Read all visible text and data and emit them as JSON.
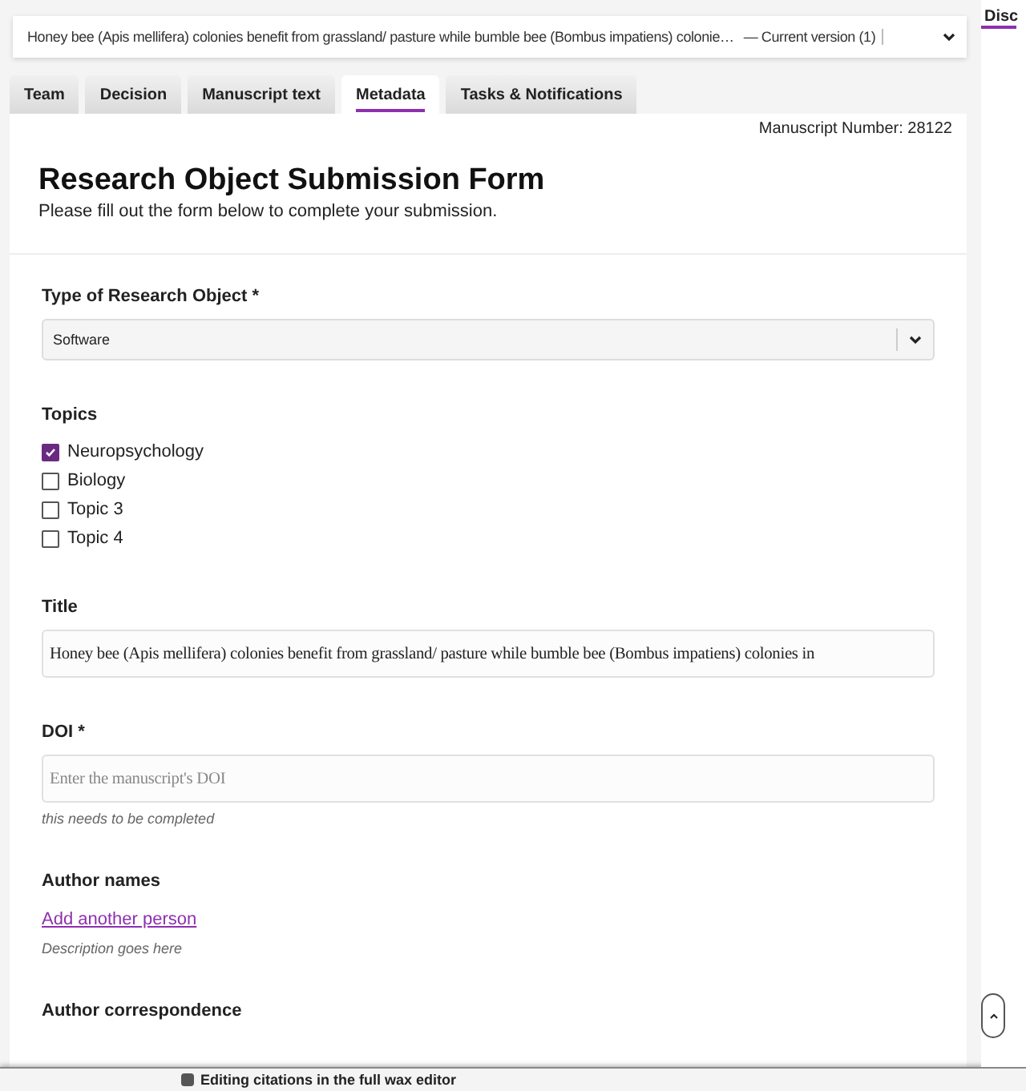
{
  "version_bar": {
    "title": "Honey bee (Apis mellifera) colonies benefit from grassland/ pasture while bumble bee (Bombus impatiens) colonie…",
    "version": "— Current version (1)"
  },
  "tabs": [
    {
      "label": "Team",
      "selected": false
    },
    {
      "label": "Decision",
      "selected": false
    },
    {
      "label": "Manuscript text",
      "selected": false
    },
    {
      "label": "Metadata",
      "selected": true
    },
    {
      "label": "Tasks & Notifications",
      "selected": false
    }
  ],
  "manuscript_number": "Manuscript Number: 28122",
  "form": {
    "heading": "Research Object Submission Form",
    "intro": "Please fill out the form below to complete your submission.",
    "fields": [
      {
        "kind": "select",
        "label": "Type of Research Object *",
        "value": "Software"
      },
      {
        "kind": "checkboxes",
        "label": "Topics",
        "options": [
          {
            "label": "Neuropsychology",
            "checked": true
          },
          {
            "label": "Biology",
            "checked": false
          },
          {
            "label": "Topic 3",
            "checked": false
          },
          {
            "label": "Topic 4",
            "checked": false
          }
        ]
      },
      {
        "kind": "text",
        "label": "Title",
        "value": "Honey bee (Apis mellifera) colonies benefit from grassland/ pasture while bumble bee (Bombus impatiens) colonies in"
      },
      {
        "kind": "text",
        "label": "DOI *",
        "placeholder": "Enter the manuscript's DOI",
        "note": "this needs to be completed"
      },
      {
        "kind": "people",
        "label": "Author names",
        "link": "Add another person",
        "note": "Description goes here"
      },
      {
        "kind": "heading",
        "label": "Author correspondence"
      }
    ]
  },
  "side_panel": {
    "tab": "Disc"
  },
  "status_bar": {
    "text": "Editing citations in the full wax editor"
  }
}
